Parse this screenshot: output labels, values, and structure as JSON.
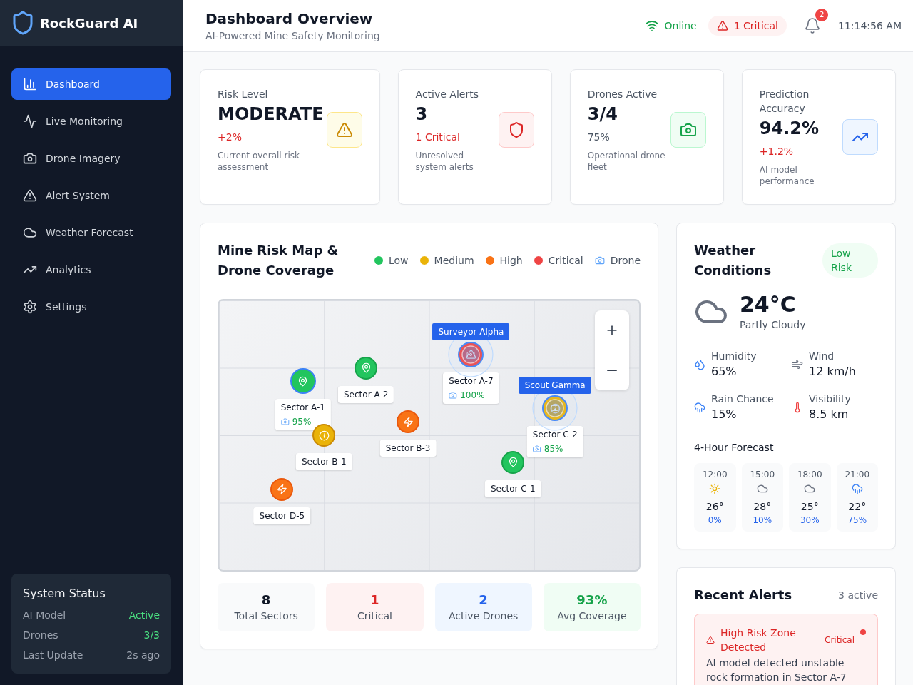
{
  "sidebar": {
    "brand": "RockGuard AI",
    "items": [
      {
        "label": "Dashboard",
        "selected": true
      },
      {
        "label": "Live Monitoring",
        "selected": false
      },
      {
        "label": "Drone Imagery",
        "selected": false
      },
      {
        "label": "Alert System",
        "selected": false
      },
      {
        "label": "Weather Forecast",
        "selected": false
      },
      {
        "label": "Analytics",
        "selected": false
      },
      {
        "label": "Settings",
        "selected": false
      }
    ],
    "system_status": {
      "title": "System Status",
      "rows": [
        {
          "label": "AI Model",
          "value": "Active",
          "kind": "ok"
        },
        {
          "label": "Drones",
          "value": "3/3",
          "kind": "ok"
        },
        {
          "label": "Last Update",
          "value": "2s ago",
          "kind": "muted"
        }
      ]
    }
  },
  "header": {
    "title": "Dashboard Overview",
    "subtitle": "AI-Powered Mine Safety Monitoring",
    "connection": "Online",
    "critical_badge": "1 Critical",
    "notifications": "2",
    "time": "11:14:56 AM"
  },
  "stat_cards": [
    {
      "label": "Risk Level",
      "value": "MODERATE",
      "change": {
        "text": "+2%",
        "kind": "negative"
      },
      "description": "Current overall risk assessment",
      "kind": "warning"
    },
    {
      "label": "Active Alerts",
      "value": "3",
      "change": {
        "text": "1 Critical",
        "kind": "negative"
      },
      "description": "Unresolved system alerts",
      "kind": "danger"
    },
    {
      "label": "Drones Active",
      "value": "3/4",
      "change": {
        "text": "75%",
        "kind": "neutral"
      },
      "description": "Operational drone fleet",
      "kind": "success"
    },
    {
      "label": "Prediction Accuracy",
      "value": "94.2%",
      "change": {
        "text": "+1.2%",
        "kind": "negative"
      },
      "description": "AI model performance",
      "kind": "info"
    }
  ],
  "risk_map": {
    "title": "Mine Risk Map & Drone Coverage",
    "legend": [
      {
        "label": "Low",
        "kind": "dot",
        "color": "#22c55e"
      },
      {
        "label": "Medium",
        "kind": "dot",
        "color": "#eab308"
      },
      {
        "label": "High",
        "kind": "dot",
        "color": "#f97316"
      },
      {
        "label": "Critical",
        "kind": "dot",
        "color": "#ef4444"
      },
      {
        "label": "Drone",
        "kind": "drone"
      }
    ],
    "sectors": [
      {
        "name": "Sector A-1",
        "kind": "low",
        "coverage": "95%"
      },
      {
        "name": "Sector A-2",
        "kind": "low"
      },
      {
        "name": "Sector A-7",
        "kind": "critical",
        "coverage": "100%"
      },
      {
        "name": "Sector B-1",
        "kind": "medium"
      },
      {
        "name": "Sector B-3",
        "kind": "high"
      },
      {
        "name": "Sector C-1",
        "kind": "low"
      },
      {
        "name": "Sector C-2",
        "kind": "medium",
        "coverage": "85%"
      },
      {
        "name": "Sector D-5",
        "kind": "high"
      }
    ],
    "drones": [
      {
        "name": "Surveyor Alpha"
      },
      {
        "name": "Scout Gamma"
      }
    ],
    "summary": [
      {
        "value": "8",
        "label": "Total Sectors",
        "kind": "neutral"
      },
      {
        "value": "1",
        "label": "Critical",
        "kind": "critical"
      },
      {
        "value": "2",
        "label": "Active Drones",
        "kind": "info"
      },
      {
        "value": "93%",
        "label": "Avg Coverage",
        "kind": "success"
      }
    ]
  },
  "weather": {
    "title": "Weather Conditions",
    "risk_badge": "Low Risk",
    "temperature": "24°C",
    "condition": "Partly Cloudy",
    "kind": "cloudy",
    "metrics": [
      {
        "label": "Humidity",
        "value": "65%"
      },
      {
        "label": "Wind",
        "value": "12 km/h"
      },
      {
        "label": "Rain Chance",
        "value": "15%"
      },
      {
        "label": "Visibility",
        "value": "8.5 km"
      }
    ],
    "forecast_title": "4-Hour Forecast",
    "forecast": [
      {
        "time": "12:00",
        "kind": "sunny",
        "temp": "26°",
        "rain": "0%"
      },
      {
        "time": "15:00",
        "kind": "cloudy",
        "temp": "28°",
        "rain": "10%"
      },
      {
        "time": "18:00",
        "kind": "cloudy",
        "temp": "25°",
        "rain": "30%"
      },
      {
        "time": "21:00",
        "kind": "rain",
        "temp": "22°",
        "rain": "75%"
      }
    ]
  },
  "alerts": {
    "title": "Recent Alerts",
    "count": "3 active",
    "items": [
      {
        "title": "High Risk Zone Detected",
        "severity": "Critical",
        "kind": "critical",
        "unread": true,
        "description": "AI model detected unstable rock formation in Sector A-7"
      }
    ]
  }
}
